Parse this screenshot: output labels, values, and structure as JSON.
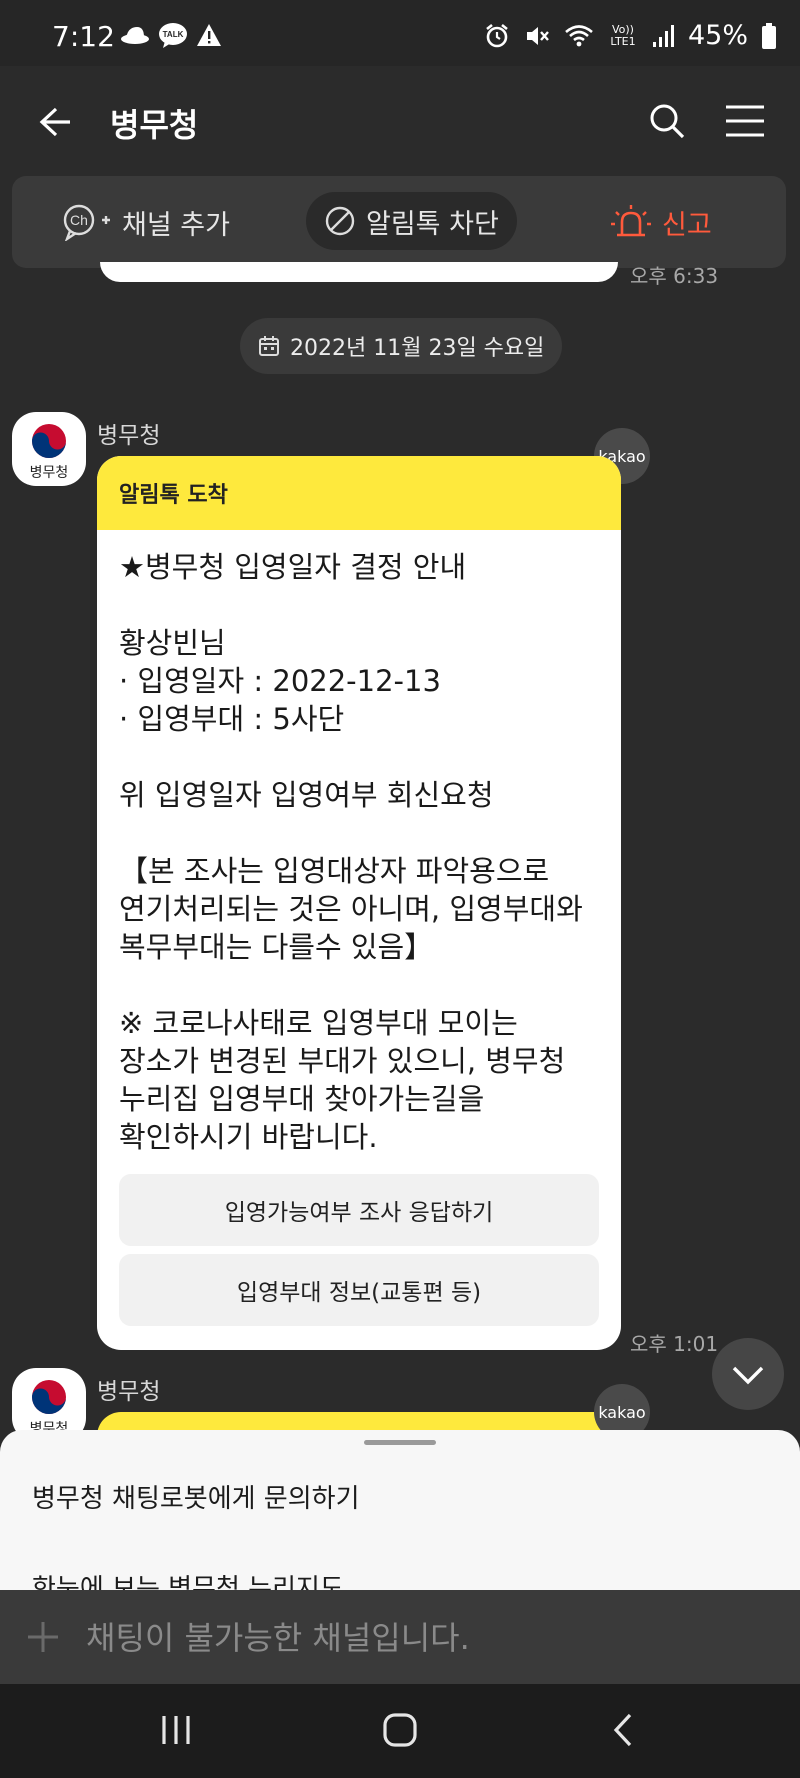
{
  "status_bar": {
    "time": "7:12",
    "notification_icons": [
      "hat-icon",
      "talk-icon",
      "warning-icon"
    ],
    "system_icons": [
      "alarm-icon",
      "mute-icon",
      "wifi-icon",
      "volte-icon",
      "signal-icon"
    ],
    "volte_label": "Vo)) LTE1",
    "battery": "45%"
  },
  "header": {
    "title": "병무청",
    "icons": [
      "back-arrow-icon",
      "search-icon",
      "menu-icon"
    ]
  },
  "action_bar": {
    "add_channel": "채널 추가",
    "block_alimtalk": "알림톡 차단",
    "report": "신고"
  },
  "prev_message": {
    "time": "오후 6:33"
  },
  "date_divider": {
    "label": "2022년 11월 23일 수요일"
  },
  "message": {
    "sender": "병무청",
    "avatar_label": "병무청",
    "badge": "kakao",
    "card_header": "알림톡 도착",
    "body": "★병무청 입영일자 결정 안내\n\n황상빈님\n· 입영일자 : 2022-12-13\n· 입영부대 : 5사단\n\n위 입영일자 입영여부 회신요청\n\n【본 조사는 입영대상자 파악용으로\n연기처리되는 것은 아니며, 입영부대와\n복무부대는 다를수 있음】\n\n※ 코로나사태로 입영부대 모이는\n장소가 변경된 부대가 있으니, 병무청\n누리집 입영부대 찾아가는길을\n확인하시기 바랍니다.",
    "buttons": [
      "입영가능여부 조사 응답하기",
      "입영부대 정보(교통편 등)"
    ],
    "time": "오후 1:01"
  },
  "next_message": {
    "sender": "병무청",
    "avatar_label": "병무청",
    "badge": "kakao"
  },
  "bottom_sheet": {
    "items": [
      "병무청 채팅로봇에게 문의하기",
      "한눈에 보는 병무청 누리지도"
    ]
  },
  "input_bar": {
    "placeholder": "채팅이 불가능한 채널입니다."
  },
  "colors": {
    "background": "#2b2b2b",
    "alimtalk_yellow": "#fee93d",
    "report_red": "#ff5a3c"
  }
}
